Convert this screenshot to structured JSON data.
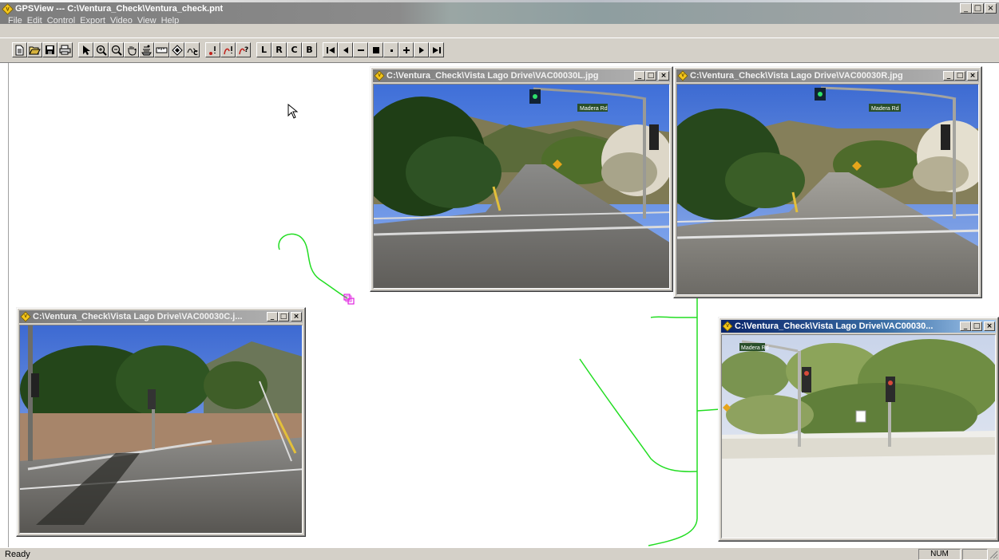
{
  "window": {
    "title": "GPSView --- C:\\Ventura_Check\\Ventura_check.pnt",
    "controls": {
      "minimize": "_",
      "maximize": "□",
      "close": "×"
    }
  },
  "menu": [
    "File",
    "Edit",
    "Control",
    "Export",
    "Video",
    "View",
    "Help"
  ],
  "toolbar": {
    "file_tools": [
      "new-icon",
      "open-icon",
      "save-icon",
      "print-icon"
    ],
    "view_tools": [
      "pointer-icon",
      "zoom-in-icon",
      "zoom-out-icon",
      "pan-hand-icon",
      "stack-icon",
      "ruler-icon",
      "target-icon",
      "curve-icon"
    ],
    "marker_tools": [
      "point-marker-icon",
      "route-marker-icon",
      "route-query-icon"
    ],
    "camera_buttons": [
      "L",
      "R",
      "C",
      "B"
    ],
    "playback": [
      "first-frame-icon",
      "step-back-icon",
      "minus-icon",
      "stop-icon",
      "dot-icon",
      "plus-icon",
      "step-forward-icon",
      "last-frame-icon"
    ]
  },
  "image_windows": [
    {
      "title": "C:\\Ventura_Check\\Vista Lago Drive\\VAC00030L.jpg",
      "state": "inactive"
    },
    {
      "title": "C:\\Ventura_Check\\Vista Lago Drive\\VAC00030R.jpg",
      "state": "inactive"
    },
    {
      "title": "C:\\Ventura_Check\\Vista Lago Drive\\VAC00030C.j...",
      "state": "inactive"
    },
    {
      "title": "C:\\Ventura_Check\\Vista Lago Drive\\VAC00030...",
      "state": "active"
    }
  ],
  "photo_labels": {
    "street_sign": "Madera Rd"
  },
  "status": {
    "text": "Ready",
    "num": "NUM"
  },
  "colors": {
    "track": "#22dd22",
    "marker": "#e020e0",
    "toolbar_bg": "#d4d0c8"
  }
}
